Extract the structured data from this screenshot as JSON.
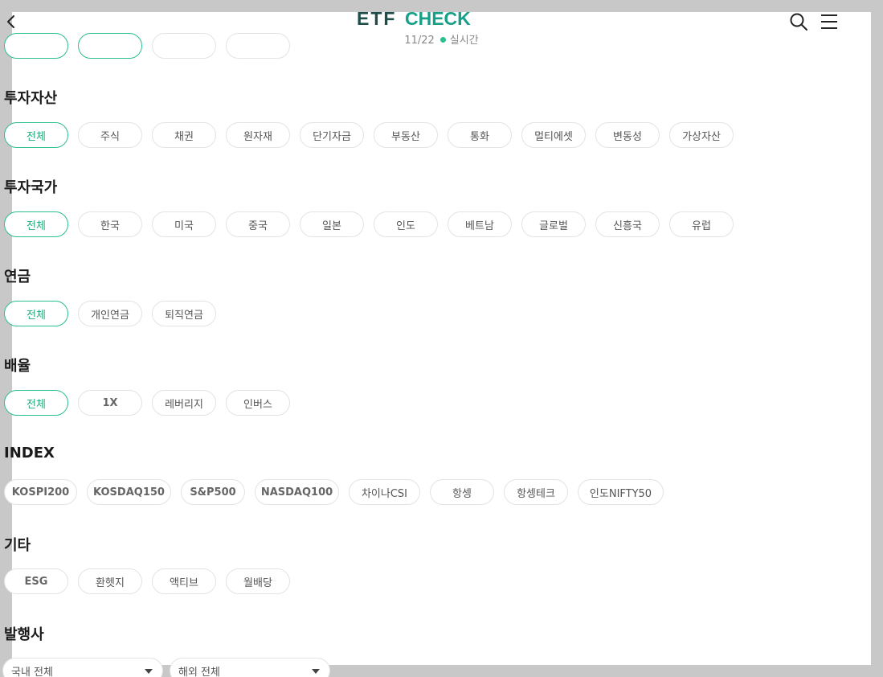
{
  "header": {
    "logo_etf": "ETF",
    "logo_check": "CHECK",
    "date": "11/22",
    "live_label": "실시간",
    "colors": {
      "logo_dark": "#1f4d4a",
      "logo_accent": "#16a08a",
      "live_dot": "#2bbf8a"
    }
  },
  "top_chips": [
    "",
    "",
    "",
    ""
  ],
  "sections": {
    "asset": {
      "title": "투자자산",
      "chips": [
        "전체",
        "주식",
        "채권",
        "원자재",
        "단기자금",
        "부동산",
        "통화",
        "멀티에셋",
        "변동성",
        "가상자산"
      ]
    },
    "country": {
      "title": "투자국가",
      "chips": [
        "전체",
        "한국",
        "미국",
        "중국",
        "일본",
        "인도",
        "베트남",
        "글로벌",
        "신흥국",
        "유럽"
      ]
    },
    "pension": {
      "title": "연금",
      "chips": [
        "전체",
        "개인연금",
        "퇴직연금"
      ]
    },
    "leverage": {
      "title": "배율",
      "chips": [
        "전체",
        "1X",
        "레버리지",
        "인버스"
      ]
    },
    "index": {
      "title": "INDEX",
      "chips": [
        "KOSPI200",
        "KOSDAQ150",
        "S&P500",
        "NASDAQ100",
        "차이나CSI",
        "항셍",
        "항셍테크",
        "인도NIFTY50"
      ]
    },
    "etc": {
      "title": "기타",
      "chips": [
        "ESG",
        "환헷지",
        "액티브",
        "월배당"
      ]
    },
    "issuer": {
      "title": "발행사",
      "domestic_select": "국내 전체",
      "overseas_select": "해외 전체"
    }
  },
  "accent_color": "#2bbf8a"
}
